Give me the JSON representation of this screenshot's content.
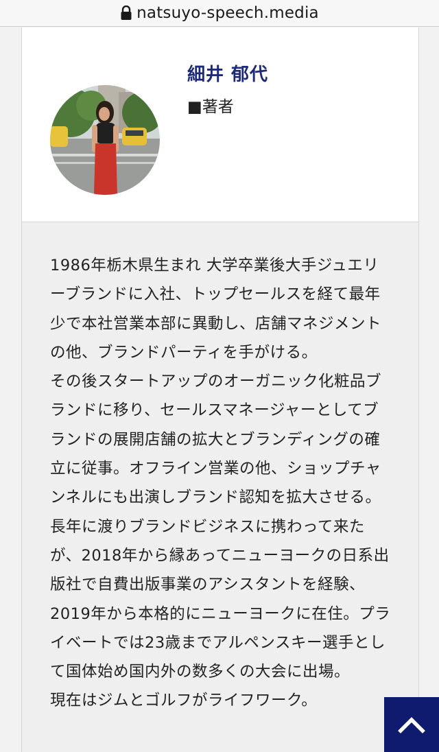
{
  "browser": {
    "url": "natsuyo-speech.media",
    "lock_icon": "lock-icon"
  },
  "author": {
    "name": "細井 郁代",
    "role": "■著者",
    "avatar": "author-photo"
  },
  "bio": {
    "paragraphs": [
      "1986年栃木県生まれ 大学卒業後大手ジュエリーブランドに入社、トップセールスを経て最年少で本社営業本部に異動し、店舗マネジメントの他、ブランドパーティを手がける。",
      "その後スタートアップのオーガニック化粧品ブランドに移り、セールスマネージャーとしてブランドの展開店舗の拡大とブランディングの確立に従事。オフライン営業の他、ショップチャンネルにも出演しブランド認知を拡大させる。長年に渡りブランドビジネスに携わって来たが、2018年から縁あってニューヨークの日系出版社で自費出版事業のアシスタントを経験、2019年から本格的にニューヨークに在住。プライベートでは23歳までアルペンスキー選手として国体始め国内外の数多くの大会に出場。",
      "現在はジムとゴルフがライフワーク。"
    ]
  },
  "scroll_top": {
    "icon": "chevron-up-icon",
    "color": "#0e1b6e"
  },
  "colors": {
    "author_name": "#1d2a7a",
    "page_bg": "#f2f2f2"
  }
}
